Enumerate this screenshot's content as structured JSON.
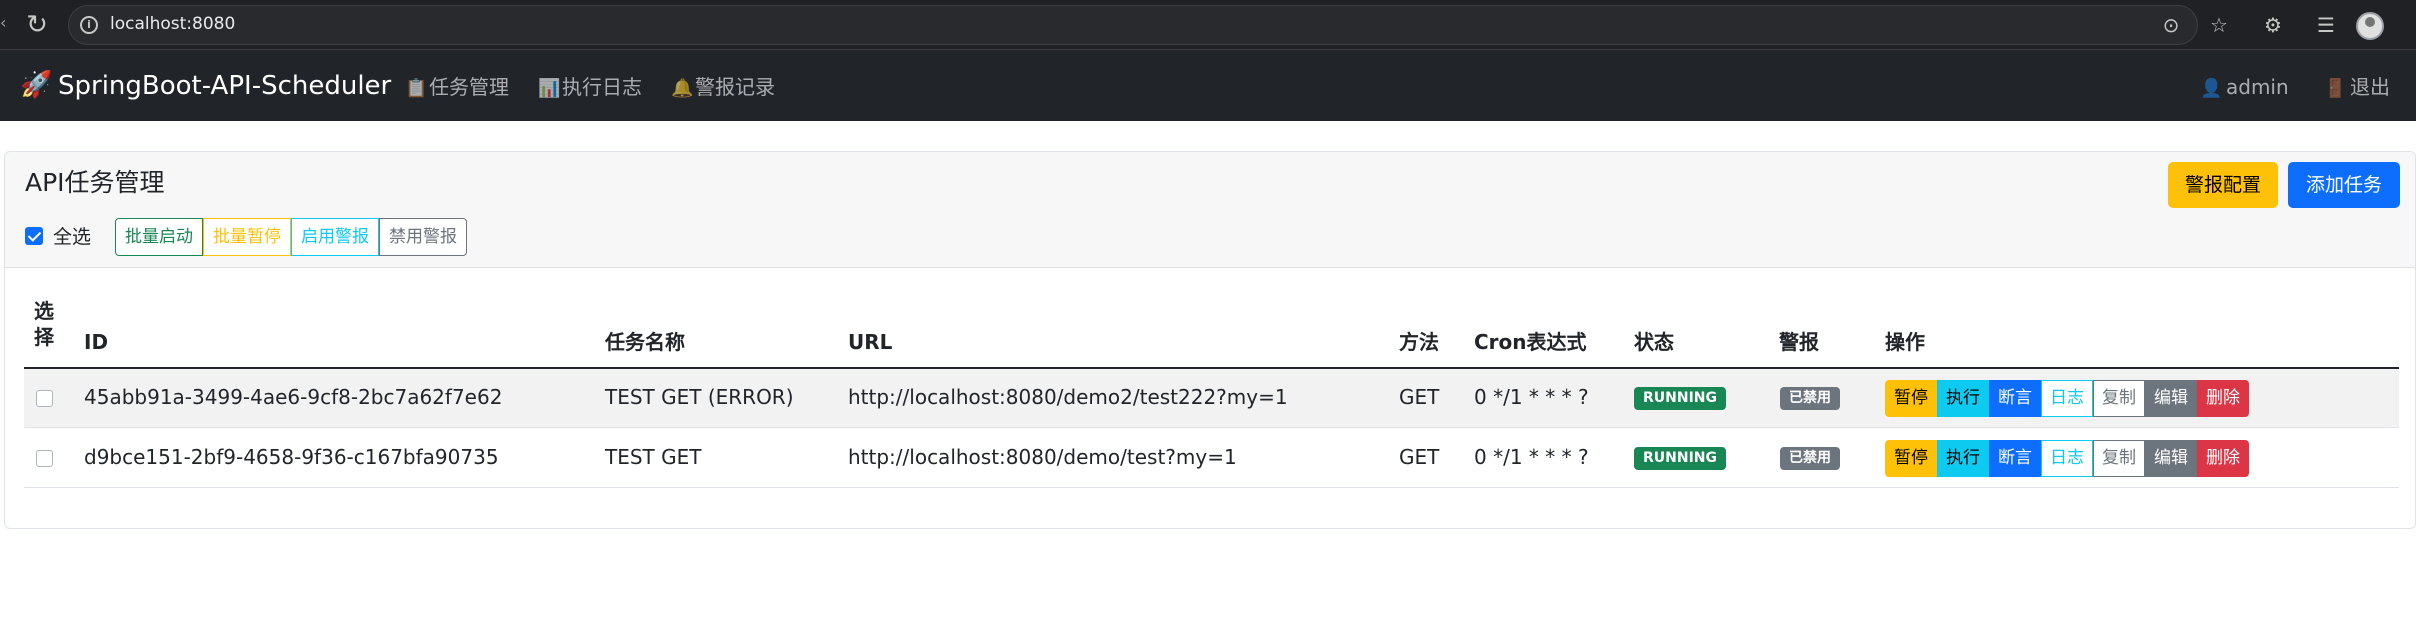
{
  "browser": {
    "url": "localhost:8080"
  },
  "navbar": {
    "brand": "SpringBoot-API-Scheduler",
    "items": [
      {
        "icon": "📋",
        "label": "任务管理"
      },
      {
        "icon": "📊",
        "label": "执行日志"
      },
      {
        "icon": "🔔",
        "label": "警报记录"
      }
    ],
    "user": {
      "icon": "👤",
      "label": "admin"
    },
    "logout": {
      "icon": "🚪",
      "label": "退出"
    }
  },
  "card": {
    "title": "API任务管理",
    "select_all_label": "全选",
    "batch_buttons": [
      "批量启动",
      "批量暂停",
      "启用警报",
      "禁用警报"
    ],
    "alert_config_label": "警报配置",
    "add_task_label": "添加任务"
  },
  "table": {
    "headers": {
      "select": "选择",
      "id": "ID",
      "name": "任务名称",
      "url": "URL",
      "method": "方法",
      "cron": "Cron表达式",
      "status": "状态",
      "alert": "警报",
      "actions": "操作"
    },
    "rows": [
      {
        "id": "45abb91a-3499-4ae6-9cf8-2bc7a62f7e62",
        "name": "TEST GET (ERROR)",
        "url": "http://localhost:8080/demo2/test222?my=1",
        "method": "GET",
        "cron": "0 */1 * * * ?",
        "status": "RUNNING",
        "alert": "已禁用"
      },
      {
        "id": "d9bce151-2bf9-4658-9f36-c167bfa90735",
        "name": "TEST GET",
        "url": "http://localhost:8080/demo/test?my=1",
        "method": "GET",
        "cron": "0 */1 * * * ?",
        "status": "RUNNING",
        "alert": "已禁用"
      }
    ],
    "action_labels": [
      "暂停",
      "执行",
      "断言",
      "日志",
      "复制",
      "编辑",
      "删除"
    ]
  }
}
